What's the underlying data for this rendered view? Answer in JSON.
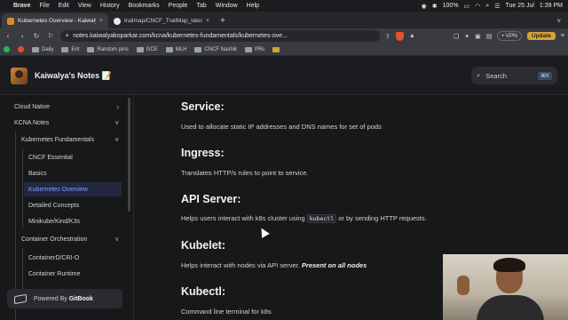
{
  "menubar": {
    "app": "Brave",
    "items": [
      "File",
      "Edit",
      "View",
      "History",
      "Bookmarks",
      "People",
      "Tab",
      "Window",
      "Help"
    ],
    "battery": "100%",
    "date": "Tue 25 Jul",
    "time": "1:39 PM"
  },
  "tabs": [
    {
      "title": "Kubernetes Overview - Kaiwaly",
      "color": "#d98a2b"
    },
    {
      "title": "trailmap/CNCF_TrailMap_latest.png",
      "color": "#e9e9e9"
    }
  ],
  "address": {
    "url": "notes.kaiwalyakoparkar.com/kcna/kubernetes-fundamentals/kubernetes-ove...",
    "vpn": "• VPN",
    "update": "Update"
  },
  "bookmarks": [
    {
      "label": "",
      "kind": "dot",
      "color": "#1db954"
    },
    {
      "label": "",
      "kind": "dot",
      "color": "#e74c3c"
    },
    {
      "label": "Daily",
      "kind": "folder"
    },
    {
      "label": "Ent",
      "kind": "folder"
    },
    {
      "label": "Random pins",
      "kind": "folder"
    },
    {
      "label": "GCE",
      "kind": "folder"
    },
    {
      "label": "MLH",
      "kind": "folder"
    },
    {
      "label": "CNCF Nashik",
      "kind": "folder"
    },
    {
      "label": "PRs",
      "kind": "folder"
    }
  ],
  "site": {
    "title": "Kaiwalya's Notes 📝",
    "search_placeholder": "Search",
    "search_kbd": "⌘K"
  },
  "sidebar": {
    "items": [
      {
        "label": "Cloud Native",
        "chev": "›"
      },
      {
        "label": "KCNA Notes",
        "chev": "˅"
      },
      {
        "label": "Kubernetes Fundamentals",
        "chev": "˅"
      },
      {
        "label": "CNCF Essential",
        "chev": ""
      },
      {
        "label": "Basics",
        "chev": ""
      },
      {
        "label": "Kubernetes Overview",
        "chev": ""
      },
      {
        "label": "Detailed Concepts",
        "chev": ""
      },
      {
        "label": "Minikube/Kind/K3s",
        "chev": ""
      },
      {
        "label": "Container Orchestration",
        "chev": "˅"
      },
      {
        "label": "ContainerD/CRI-O",
        "chev": ""
      },
      {
        "label": "Container Runtime",
        "chev": ""
      }
    ],
    "powered_prefix": "Powered By ",
    "powered_brand": "GitBook"
  },
  "content": {
    "service_h": "Service:",
    "service_p": "Used to allocate static IP addresses and DNS names for set of pods",
    "ingress_h": "Ingress:",
    "ingress_p": "Translates HTTP/s rules to point to service.",
    "api_h": "API Server:",
    "api_p1": "Helps users interact with k8s cluster using ",
    "api_code": "kubectl",
    "api_p2": " or by sending HTTP requests.",
    "kubelet_h": "Kubelet:",
    "kubelet_p": "Helps interact with nodes via API server. ",
    "kubelet_em": "Present on all nodes",
    "kubectl_h": "Kubectl:",
    "kubectl_p": "Command line terminal for k8s"
  }
}
